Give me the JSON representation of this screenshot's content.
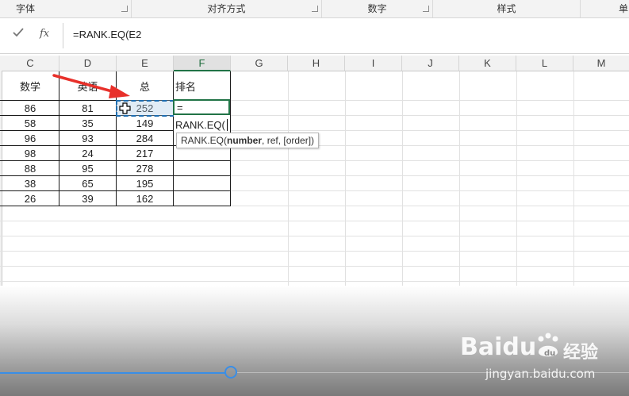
{
  "ribbon": {
    "groups": [
      "字体",
      "对齐方式",
      "数字",
      "样式",
      "单"
    ]
  },
  "formula_bar": {
    "confirm_icon": "checkmark-icon",
    "function_icon": "fx-icon",
    "function_label": "fx",
    "formula": "=RANK.EQ(E2"
  },
  "sheet": {
    "columns": [
      "C",
      "D",
      "E",
      "F",
      "G",
      "H",
      "I",
      "J",
      "K",
      "L",
      "M"
    ],
    "headers": {
      "c": "数学",
      "d": "英语",
      "e": "总",
      "f": "排名"
    },
    "rows": [
      {
        "c": "86",
        "d": "81",
        "e": "252"
      },
      {
        "c": "58",
        "d": "35",
        "e": "149"
      },
      {
        "c": "96",
        "d": "93",
        "e": "284"
      },
      {
        "c": "98",
        "d": "24",
        "e": "217"
      },
      {
        "c": "88",
        "d": "95",
        "e": "278"
      },
      {
        "c": "38",
        "d": "65",
        "e": "195"
      },
      {
        "c": "26",
        "d": "39",
        "e": "162"
      }
    ],
    "edit_cell": {
      "line1": "=",
      "line2": "RANK.EQ("
    },
    "tooltip": {
      "fn": "RANK.EQ(",
      "arg_bold": "number",
      "rest": ", ref, [order])"
    }
  },
  "watermark": {
    "brand": "Baidu",
    "product": "经验",
    "url": "jingyan.baidu.com"
  },
  "colors": {
    "accent": "#217346",
    "arrow": "#e8302a",
    "marquee": "#1f6fb2",
    "slider": "#3a8ee6"
  }
}
